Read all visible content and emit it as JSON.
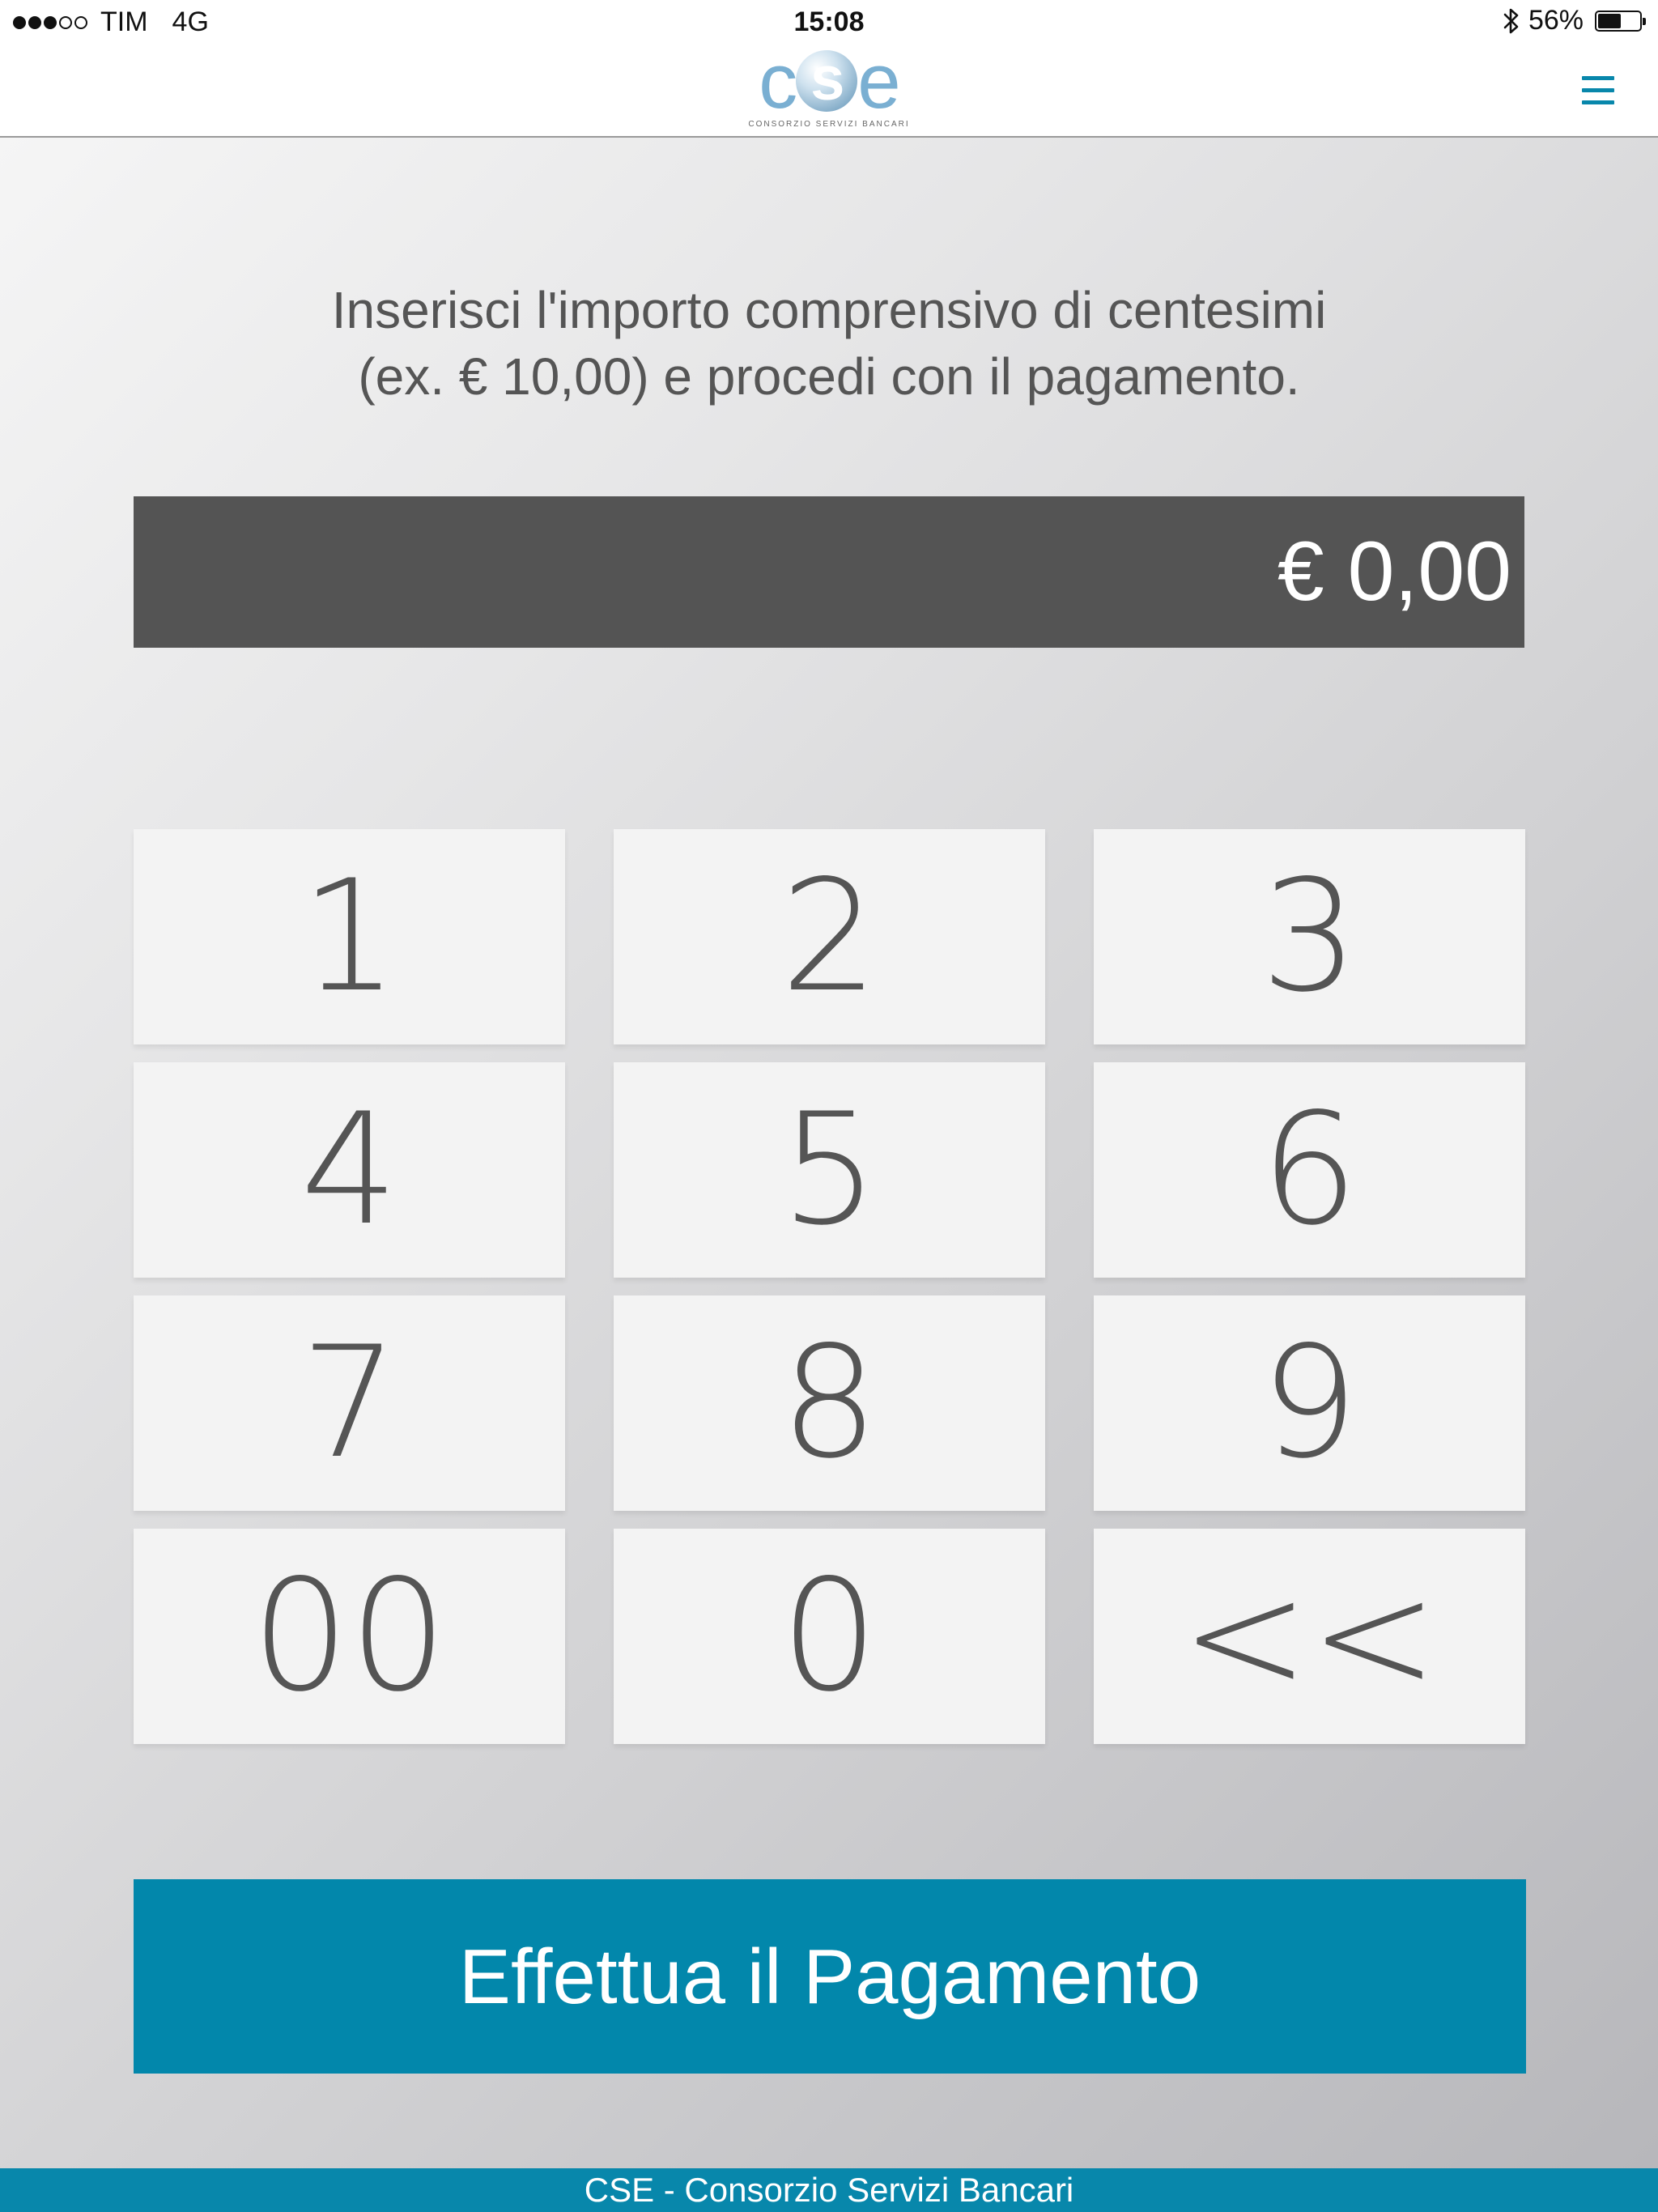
{
  "status_bar": {
    "signal_filled": 3,
    "signal_total": 5,
    "carrier": "TIM",
    "network": "4G",
    "time": "15:08",
    "bluetooth_icon": "bluetooth-icon",
    "battery_percent_label": "56%",
    "battery_level": 56
  },
  "header": {
    "logo_text": "cse",
    "logo_letters": {
      "c": "c",
      "s": "s",
      "e": "e"
    },
    "logo_subtitle": "CONSORZIO SERVIZI BANCARI",
    "menu_icon": "hamburger-menu-icon",
    "accent_color": "#0887ab"
  },
  "instructions": {
    "line1": "Inserisci l'importo comprensivo di centesimi",
    "line2": "(ex. € 10,00) e procedi con il pagamento."
  },
  "amount": {
    "value": "€ 0,00"
  },
  "keypad": {
    "keys": [
      "1",
      "2",
      "3",
      "4",
      "5",
      "6",
      "7",
      "8",
      "9",
      "00",
      "0",
      "<<"
    ]
  },
  "pay_button": {
    "label": "Effettua il Pagamento",
    "color": "#0287ab"
  },
  "footer": {
    "text": "CSE - Consorzio Servizi Bancari"
  }
}
